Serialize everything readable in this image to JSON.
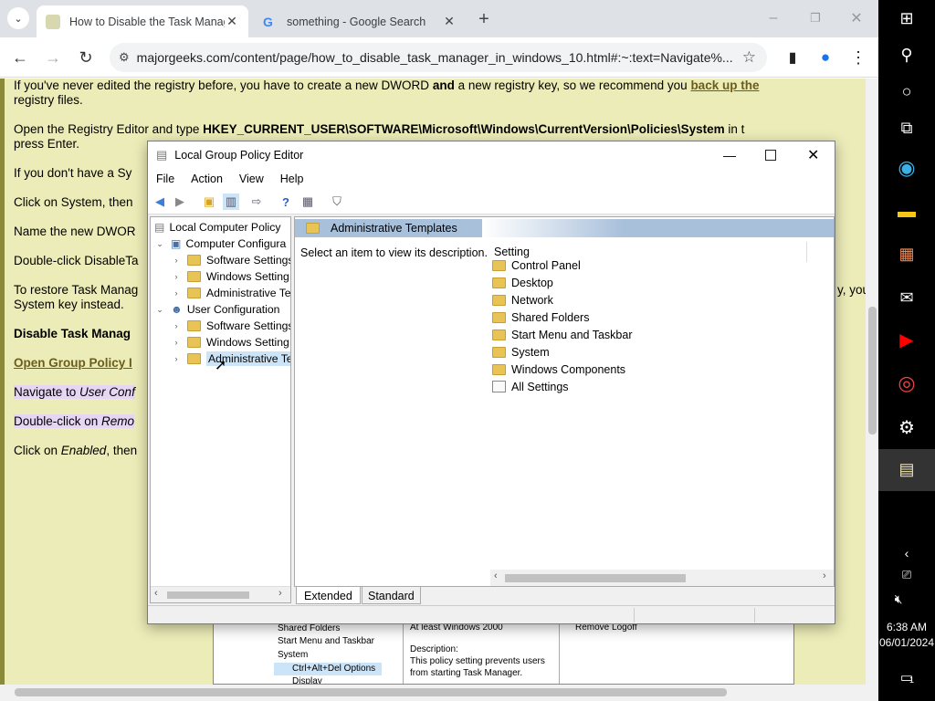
{
  "browser": {
    "tabs": [
      {
        "title": "How to Disable the Task Manag"
      },
      {
        "title": "something - Google Search"
      }
    ],
    "url": "majorgeeks.com/content/page/how_to_disable_task_manager_in_windows_10.html#:~:text=Navigate%..."
  },
  "article": {
    "p1a": "If you've never edited the registry before, you have to create a new DWORD ",
    "p1b": "and",
    "p1c": " a new registry key, so we recommend you ",
    "p1link": "back up the",
    "p1d": "registry files.",
    "p2a": "Open the Registry Editor and type ",
    "p2b": "HKEY_CURRENT_USER\\SOFTWARE\\Microsoft\\Windows\\CurrentVersion\\Policies\\System",
    "p2c": " in t",
    "p2d": "press Enter.",
    "p3": "If you don't have a Sy",
    "p4": "Click on System, then",
    "p5": "Name the new DWOR",
    "p6": "Double-click DisableTa",
    "p7a": "To restore Task Manag",
    "p7b": "y, you",
    "p7c": "System key instead.",
    "p8": "Disable Task Manag",
    "p9": "Open Group Policy I",
    "p10a": "Navigate to ",
    "p10b": "User Conf",
    "p11a": "Double-click on ",
    "p11b": "Remo",
    "p12a": "Click on ",
    "p12b": "Enabled",
    "p12c": ", then"
  },
  "inner_screenshot": {
    "tree": [
      "Shared Folders",
      "Start Menu and Taskbar",
      "System",
      "Ctrl+Alt+Del Options",
      "Display"
    ],
    "req": "At least Windows 2000",
    "desc_label": "Description:",
    "desc1": "This policy setting prevents users",
    "desc2": "from starting Task Manager.",
    "remove_logoff": "Remove Logoff"
  },
  "dialog": {
    "title": "Local Group Policy Editor",
    "menu": [
      "File",
      "Action",
      "View",
      "Help"
    ],
    "tree": [
      {
        "label": "Local Computer Policy"
      },
      {
        "label": "Computer Configura"
      },
      {
        "label": "Software Settings"
      },
      {
        "label": "Windows Setting"
      },
      {
        "label": "Administrative Te"
      },
      {
        "label": "User Configuration"
      },
      {
        "label": "Software Settings"
      },
      {
        "label": "Windows Setting"
      },
      {
        "label": "Administrative Te"
      }
    ],
    "header": "Administrative Templates",
    "description_prompt": "Select an item to view its description.",
    "column_setting": "Setting",
    "items": [
      "Control Panel",
      "Desktop",
      "Network",
      "Shared Folders",
      "Start Menu and Taskbar",
      "System",
      "Windows Components",
      "All Settings"
    ],
    "tab_extended": "Extended",
    "tab_standard": "Standard"
  },
  "taskbar": {
    "time": "6:38 AM",
    "date": "06/01/2024",
    "notifications": "1"
  },
  "colors": {
    "page_bg": "#ececb8",
    "link": "#6b5d1a",
    "selection": "#cce4f7"
  }
}
